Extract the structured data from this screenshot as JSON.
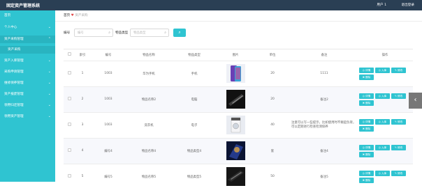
{
  "app": {
    "title": "固定资产管理系统",
    "user": "用户 1",
    "logout": "退出登录"
  },
  "sidebar": {
    "items": [
      {
        "label": "首页",
        "chevron": ""
      },
      {
        "label": "个人中心",
        "chevron": "⌄"
      },
      {
        "label": "资产采购管理",
        "chevron": "⌃"
      },
      {
        "label": "资产采购",
        "chevron": ""
      },
      {
        "label": "资产入库管理",
        "chevron": "⌄"
      },
      {
        "label": "采购申请管理",
        "chevron": "⌄"
      },
      {
        "label": "维修保养管理",
        "chevron": "⌄"
      },
      {
        "label": "资产报废管理",
        "chevron": "⌄"
      },
      {
        "label": "领用归还管理",
        "chevron": "⌄"
      },
      {
        "label": "领用资产管理",
        "chevron": "⌄"
      }
    ]
  },
  "breadcrumb": {
    "home": "首页",
    "heart": "♥",
    "current": "资产采购"
  },
  "search": {
    "label1": "编号",
    "placeholder1": "编号",
    "label2": "物品类型",
    "placeholder2": "物品类型",
    "button_icon": "⌕"
  },
  "table": {
    "headers": [
      "",
      "索引",
      "编号",
      "物品名称",
      "物品类型",
      "图片",
      "单位",
      "备注",
      "操作"
    ],
    "rows": [
      {
        "idx": "1",
        "code": "1003",
        "name": "华为手机",
        "type": "手机",
        "unit": "20",
        "note": "1111",
        "img": "phone1"
      },
      {
        "idx": "2",
        "code": "1003",
        "name": "物品名称2",
        "type": "电脑",
        "unit": "20",
        "note": "备注2",
        "img": "phone2"
      },
      {
        "idx": "3",
        "code": "1003",
        "name": "洗衣机",
        "type": "电子",
        "unit": "40",
        "note": "注意可以写一些提示，比如使用时不要超负荷，可以定期进行检查检测保养",
        "img": "washer"
      },
      {
        "idx": "4",
        "code": "编号4",
        "name": "物品名称4",
        "type": "物品类型4",
        "unit": "套",
        "note": "备注4",
        "img": "phone4"
      },
      {
        "idx": "5",
        "code": "编号5",
        "name": "物品名称5",
        "type": "物品类型5",
        "unit": "50",
        "note": "备注5",
        "img": "phone5"
      }
    ],
    "buttons": {
      "detail": "◎ 详情",
      "in": "◎ 入库",
      "edit": "✎ 修改",
      "delete": "✖ 删除"
    }
  },
  "side_tab": {
    "icon": "‹"
  },
  "colors": {
    "topbar": "#2a3f54",
    "sidebar": "#2fc4d1",
    "accent": "#2fc4d1"
  }
}
